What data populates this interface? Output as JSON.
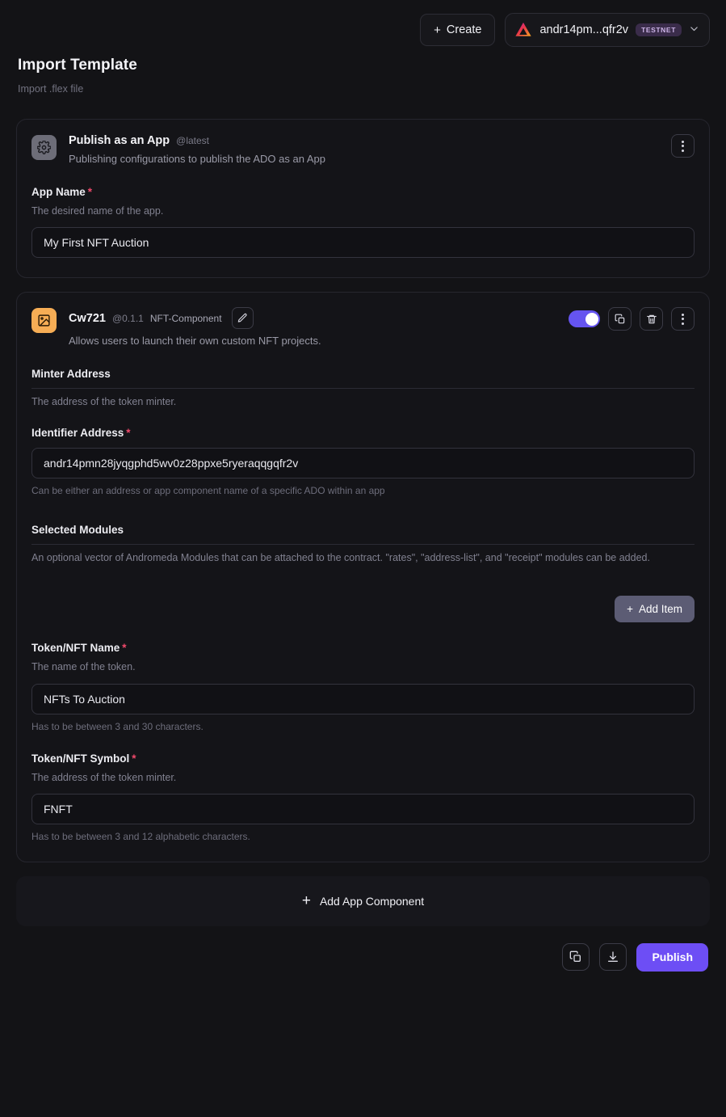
{
  "topbar": {
    "create_label": "+ Create",
    "create_plus": "+",
    "create_text": "Create",
    "wallet_address": "andr14pm...qfr2v",
    "network_badge": "TESTNET",
    "chevron": "⌄"
  },
  "header": {
    "title": "Import Template",
    "subtitle": "Import .flex file"
  },
  "cards": [
    {
      "icon": "gear-icon",
      "name": "Publish as an App",
      "version": "@latest",
      "type": "",
      "description": "Publishing configurations to publish the ADO as an App",
      "fields": [
        {
          "label": "App Name",
          "required": "*",
          "help": "The desired name of the app.",
          "value": "My First NFT Auction",
          "hint": ""
        }
      ]
    },
    {
      "icon": "image-icon",
      "name": "Cw721",
      "version": "@0.1.1",
      "type": "NFT-Component",
      "description": "Allows users to launch their own custom NFT projects.",
      "fields": [
        {
          "label": "Minter Address",
          "required": "",
          "help": "The address of the token minter.",
          "value": null,
          "hint": ""
        },
        {
          "label": "Identifier Address",
          "required": "*",
          "help": "",
          "value": "andr14pmn28jyqgphd5wv0z28ppxe5ryeraqqgqfr2v",
          "hint": "Can be either an address or app component name of a specific ADO within an app"
        },
        {
          "label": "Selected Modules",
          "required": "",
          "help": "An optional vector of Andromeda Modules that can be attached to the contract. \"rates\", \"address-list\", and \"receipt\" modules can be added.",
          "value": null,
          "hint": "",
          "add_item_label": "Add Item",
          "add_item_plus": "+"
        },
        {
          "label": "Token/NFT Name",
          "required": "*",
          "help": "The name of the token.",
          "value": "NFTs To Auction",
          "hint": "Has to be between 3 and 30 characters."
        },
        {
          "label": "Token/NFT Symbol",
          "required": "*",
          "help": "The address of the token minter.",
          "value": "FNFT",
          "hint": "Has to be between 3 and 12 alphabetic characters."
        }
      ]
    }
  ],
  "add_component": {
    "plus": "+",
    "label": "Add App Component"
  },
  "footer": {
    "publish_label": "Publish"
  },
  "colors": {
    "accent_purple": "#6d4ef5",
    "toggle_on": "#6554f0",
    "required_red": "#f0496b",
    "icon_orange": "#f6ad55",
    "badge_bg": "#3a2c4a",
    "page_bg": "#131316",
    "card_bg": "#141418"
  }
}
